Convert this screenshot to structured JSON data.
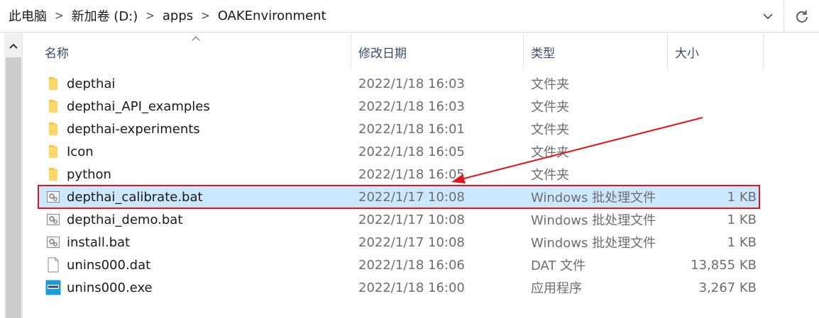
{
  "breadcrumb": {
    "items": [
      "此电脑",
      "新加卷 (D:)",
      "apps",
      "OAKEnvironment"
    ]
  },
  "columns": {
    "name": "名称",
    "date": "修改日期",
    "type": "类型",
    "size": "大小"
  },
  "files": [
    {
      "name": "depthai",
      "date": "2022/1/18 16:03",
      "type": "文件夹",
      "size": "",
      "icon": "folder-icon"
    },
    {
      "name": "depthai_API_examples",
      "date": "2022/1/18 16:03",
      "type": "文件夹",
      "size": "",
      "icon": "folder-icon"
    },
    {
      "name": "depthai-experiments",
      "date": "2022/1/18 16:01",
      "type": "文件夹",
      "size": "",
      "icon": "folder-icon"
    },
    {
      "name": "Icon",
      "date": "2022/1/18 16:05",
      "type": "文件夹",
      "size": "",
      "icon": "folder-icon"
    },
    {
      "name": "python",
      "date": "2022/1/18 16:05",
      "type": "文件夹",
      "size": "",
      "icon": "folder-icon"
    },
    {
      "name": "depthai_calibrate.bat",
      "date": "2022/1/17 10:08",
      "type": "Windows 批处理文件",
      "size": "1 KB",
      "icon": "batch-file-icon"
    },
    {
      "name": "depthai_demo.bat",
      "date": "2022/1/17 10:08",
      "type": "Windows 批处理文件",
      "size": "1 KB",
      "icon": "batch-file-icon"
    },
    {
      "name": "install.bat",
      "date": "2022/1/17 10:08",
      "type": "Windows 批处理文件",
      "size": "1 KB",
      "icon": "batch-file-icon"
    },
    {
      "name": "unins000.dat",
      "date": "2022/1/18 16:06",
      "type": "DAT 文件",
      "size": "13,855 KB",
      "icon": "document-icon"
    },
    {
      "name": "unins000.exe",
      "date": "2022/1/18 16:00",
      "type": "应用程序",
      "size": "3,267 KB",
      "icon": "installer-exe-icon"
    }
  ],
  "colors": {
    "selection_bg": "#cce8ff",
    "annotation_red": "#e2161a",
    "folder_yellow": "#f8c74a"
  }
}
